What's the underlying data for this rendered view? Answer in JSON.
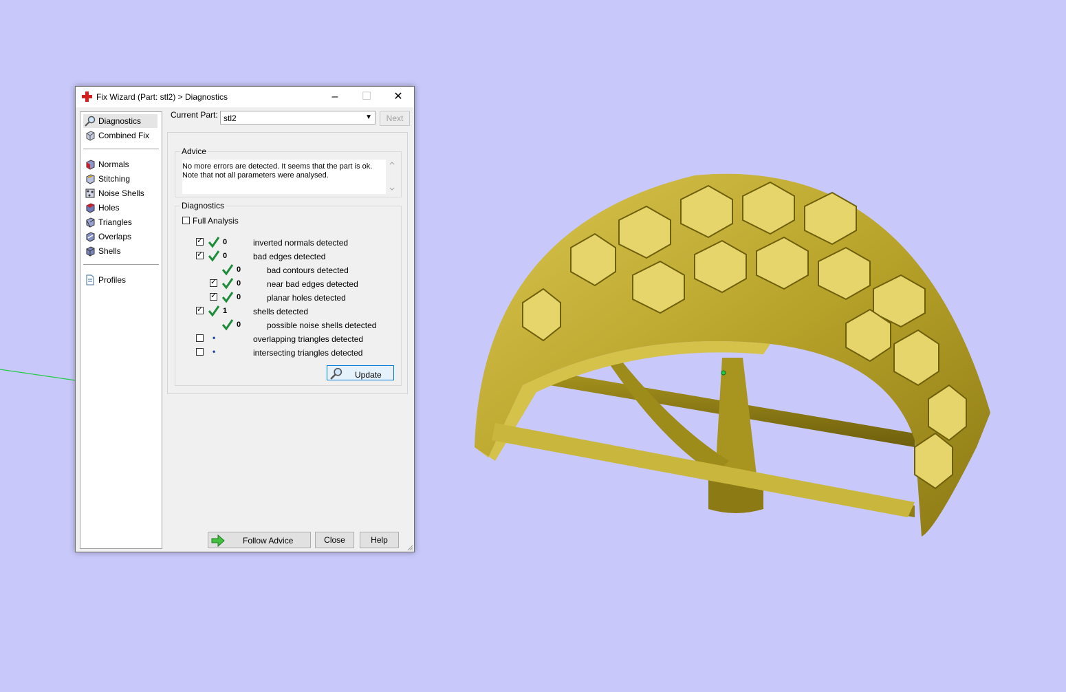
{
  "window": {
    "title": "Fix Wizard (Part: stl2) > Diagnostics",
    "minimize": "–",
    "maximize": "☐",
    "close": "✕"
  },
  "nav": {
    "items": [
      {
        "label": "Diagnostics",
        "icon": "magnifier-icon",
        "selected": true
      },
      {
        "label": "Combined Fix",
        "icon": "cube-icon"
      },
      {
        "label": "Normals",
        "icon": "normals-cube-icon"
      },
      {
        "label": "Stitching",
        "icon": "stitching-cube-icon"
      },
      {
        "label": "Noise Shells",
        "icon": "noise-shells-icon"
      },
      {
        "label": "Holes",
        "icon": "holes-cube-icon"
      },
      {
        "label": "Triangles",
        "icon": "triangles-cube-icon"
      },
      {
        "label": "Overlaps",
        "icon": "overlaps-cube-icon"
      },
      {
        "label": "Shells",
        "icon": "shells-cube-icon"
      },
      {
        "label": "Profiles",
        "icon": "document-icon"
      }
    ]
  },
  "current_part": {
    "label": "Current Part:",
    "value": "stl2",
    "next": "Next"
  },
  "advice": {
    "title": "Advice",
    "line1": "No more errors are detected. It seems that the part is ok.",
    "line2": "Note that not all parameters were analysed."
  },
  "diagnostics": {
    "title": "Diagnostics",
    "full_analysis": "Full Analysis",
    "rows": [
      {
        "checked": true,
        "status": "ok",
        "count": "0",
        "label": "inverted normals detected",
        "indent": 0
      },
      {
        "checked": true,
        "status": "ok",
        "count": "0",
        "label": "bad edges detected",
        "indent": 0
      },
      {
        "checked": null,
        "status": "ok",
        "count": "0",
        "label": "bad contours detected",
        "indent": 1
      },
      {
        "checked": true,
        "status": "ok",
        "count": "0",
        "label": "near bad edges detected",
        "indent": 1
      },
      {
        "checked": true,
        "status": "ok",
        "count": "0",
        "label": "planar holes detected",
        "indent": 1
      },
      {
        "checked": true,
        "status": "ok",
        "count": "1",
        "label": "shells detected",
        "indent": 0
      },
      {
        "checked": null,
        "status": "ok",
        "count": "0",
        "label": "possible noise shells detected",
        "indent": 1
      },
      {
        "checked": false,
        "status": "unknown",
        "count": "•",
        "label": "overlapping triangles detected",
        "indent": 0
      },
      {
        "checked": false,
        "status": "unknown",
        "count": "•",
        "label": "intersecting triangles detected",
        "indent": 0
      }
    ],
    "update": "Update"
  },
  "footer": {
    "follow_advice": "Follow Advice",
    "close": "Close",
    "help": "Help"
  },
  "colors": {
    "viewport_bg": "#c8c8fa",
    "model_gold": "#b8a32a",
    "check_green": "#1e8c3a",
    "axis_green": "#22cc44"
  }
}
